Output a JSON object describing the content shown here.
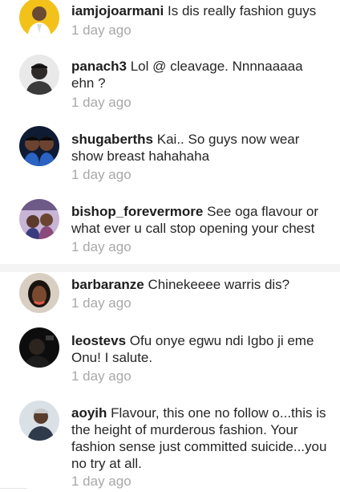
{
  "comments": [
    {
      "username": "iamjojoarmani",
      "text": "Is dis really fashion guys",
      "time": "1 day ago",
      "avatar_icon": "user-avatar-icon"
    },
    {
      "username": "panach3",
      "text": "Lol @ cleavage. Nnnnaaaaa ehn ?",
      "time": "1 day ago",
      "avatar_icon": "user-avatar-icon"
    },
    {
      "username": "shugaberths",
      "text": "Kai.. So guys now wear show breast hahahaha",
      "time": "1 day ago",
      "avatar_icon": "user-avatar-icon"
    },
    {
      "username": "bishop_forevermore",
      "text": "See oga flavour or what ever u call stop opening your chest",
      "time": "1 day ago",
      "avatar_icon": "user-avatar-icon"
    },
    {
      "username": "barbaranze",
      "text": "Chinekeeee warris dis?",
      "time": "1 day ago",
      "avatar_icon": "user-avatar-icon"
    },
    {
      "username": "leostevs",
      "text": "Ofu onye egwu ndi Igbo ji eme Onu! I salute.",
      "time": "1 day ago",
      "avatar_icon": "user-avatar-icon"
    },
    {
      "username": "aoyih",
      "text": "Flavour, this one no follow o...this is the height of murderous fashion. Your fashion sense just committed suicide...you no try at all.",
      "time": "1 day ago",
      "avatar_icon": "user-avatar-icon"
    }
  ],
  "colors": {
    "username": "#1d1d1d",
    "text": "#262626",
    "timestamp": "#a8a8a8",
    "divider": "#f4f4f4"
  }
}
